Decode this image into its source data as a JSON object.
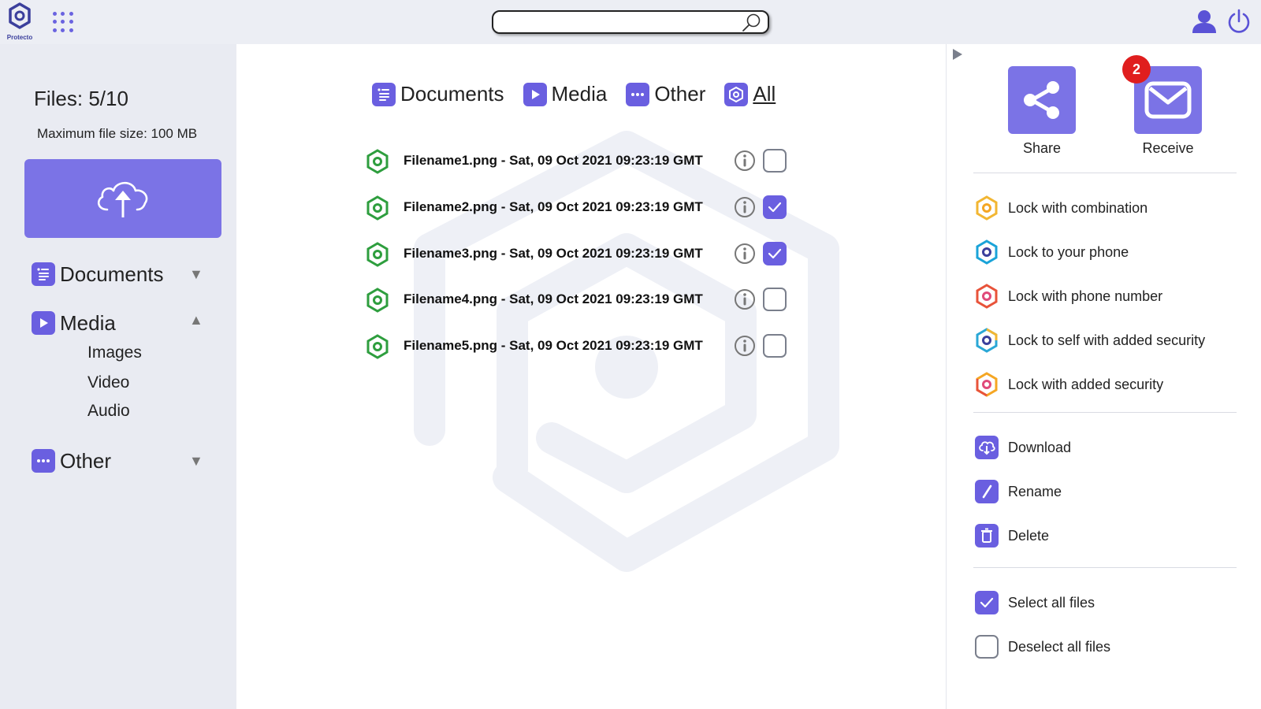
{
  "app": {
    "logo_text": "Protecto"
  },
  "search": {
    "placeholder": ""
  },
  "sidebar": {
    "files_count": "Files: 5/10",
    "max_size": "Maximum file size: 100 MB",
    "categories": [
      {
        "label": "Documents",
        "expanded": false
      },
      {
        "label": "Media",
        "expanded": true,
        "sub": [
          "Images",
          "Video",
          "Audio"
        ]
      },
      {
        "label": "Other",
        "expanded": false
      }
    ]
  },
  "main": {
    "tabs": [
      {
        "label": "Documents"
      },
      {
        "label": "Media"
      },
      {
        "label": "Other"
      },
      {
        "label": "All",
        "active": true
      }
    ],
    "files": [
      {
        "name": "Filename1.png - Sat, 09 Oct 2021 09:23:19 GMT",
        "checked": false
      },
      {
        "name": "Filename2.png - Sat, 09 Oct 2021 09:23:19 GMT",
        "checked": true
      },
      {
        "name": "Filename3.png - Sat, 09 Oct 2021 09:23:19 GMT",
        "checked": true
      },
      {
        "name": "Filename4.png - Sat, 09 Oct 2021 09:23:19 GMT",
        "checked": false
      },
      {
        "name": "Filename5.png - Sat, 09 Oct 2021 09:23:19 GMT",
        "checked": false
      }
    ]
  },
  "right_panel": {
    "share_label": "Share",
    "receive_label": "Receive",
    "receive_badge": "2",
    "lock_options": [
      {
        "label": "Lock with combination",
        "icon": "lock-combination-icon"
      },
      {
        "label": "Lock to your phone",
        "icon": "lock-phone-icon"
      },
      {
        "label": "Lock with phone number",
        "icon": "lock-phone-number-icon"
      },
      {
        "label": "Lock to self with added security",
        "icon": "lock-self-security-icon"
      },
      {
        "label": "Lock with added security",
        "icon": "lock-added-security-icon"
      }
    ],
    "file_actions": [
      {
        "label": "Download"
      },
      {
        "label": "Rename"
      },
      {
        "label": "Delete"
      }
    ],
    "select_all": "Select all files",
    "deselect_all": "Deselect all files"
  },
  "colors": {
    "accent": "#6a5fe0",
    "accent_light": "#7b73e6",
    "sidebar_bg": "#e9ebf2",
    "file_icon_green": "#2e9e3e",
    "badge_red": "#e01e1e"
  }
}
